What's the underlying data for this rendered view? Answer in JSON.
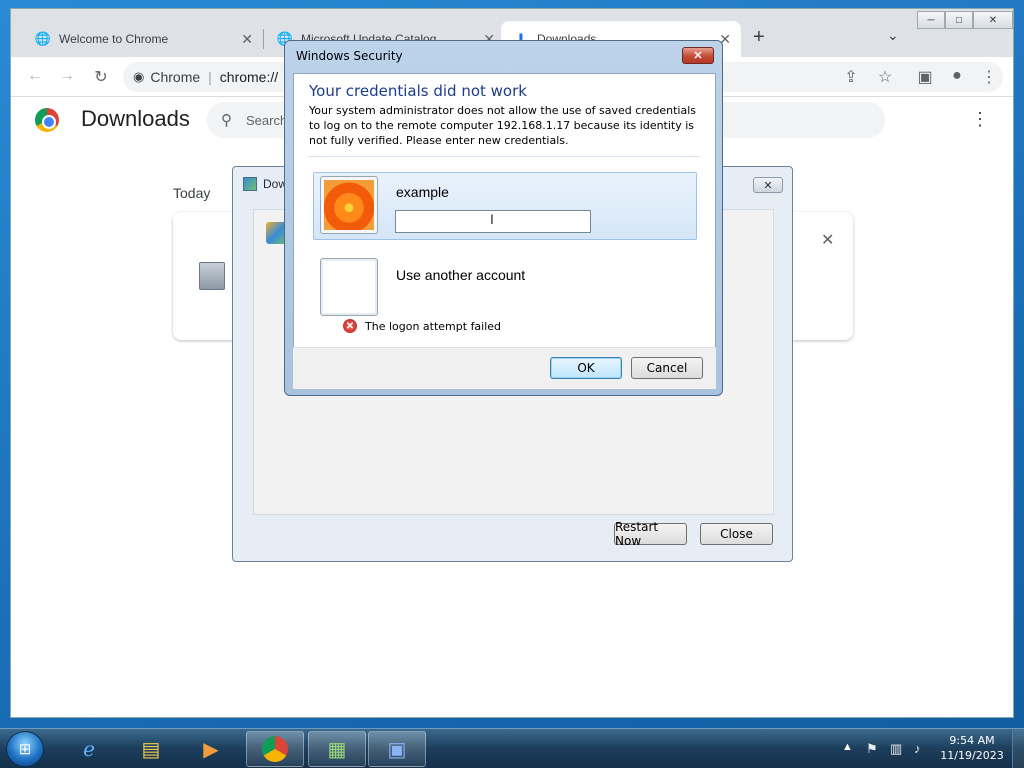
{
  "browser": {
    "tabs": [
      {
        "label": "Welcome to Chrome",
        "icon": "globe-icon"
      },
      {
        "label": "Microsoft Update Catalog",
        "icon": "globe-icon"
      },
      {
        "label": "Downloads",
        "icon": "download-icon"
      }
    ],
    "omnibox": {
      "site": "Chrome",
      "url": "chrome://"
    },
    "window_controls": {
      "minimize": "─",
      "maximize": "□",
      "close": "✕"
    }
  },
  "downloads_page": {
    "title": "Downloads",
    "search_placeholder": "Search",
    "section": "Today"
  },
  "update_dialog": {
    "title": "Dow",
    "restart_label": "Restart Now",
    "close_label": "Close"
  },
  "security_dialog": {
    "title": "Windows Security",
    "heading": "Your credentials did not work",
    "description": "Your system administrator does not allow the use of saved credentials to log on to the remote computer 192.168.1.17 because its identity is not fully verified. Please enter new credentials.",
    "account_name": "example",
    "password_value": "",
    "other_account_label": "Use another account",
    "error_text": "The logon attempt failed",
    "ok_label": "OK",
    "cancel_label": "Cancel",
    "close_glyph": "✕"
  },
  "taskbar": {
    "clock_time": "9:54 AM",
    "clock_date": "11/19/2023",
    "tray_arrow": "▲"
  }
}
